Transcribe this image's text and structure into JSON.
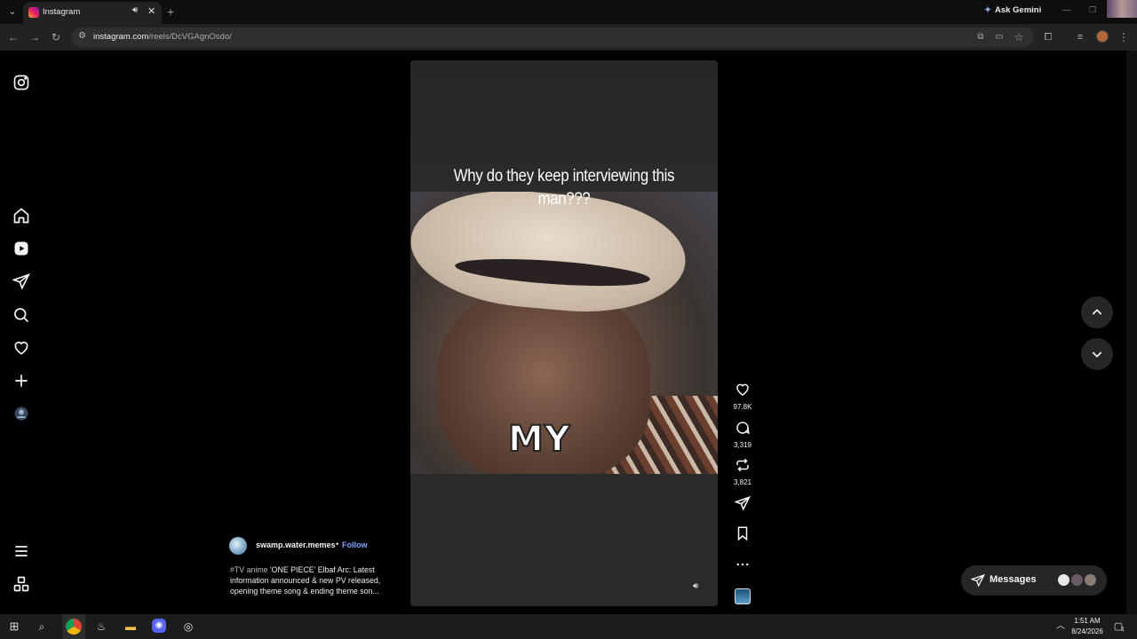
{
  "browser": {
    "tab_title": "Instagram",
    "new_tab_symbol": "+",
    "ask_gemini": "Ask Gemini",
    "url_host": "instagram.com",
    "url_path": "/reels/DcVGAgnOsdo/"
  },
  "sidebar": {
    "items": [
      {
        "name": "instagram-logo-icon"
      },
      {
        "name": "home-icon"
      },
      {
        "name": "reels-icon"
      },
      {
        "name": "messages-icon"
      },
      {
        "name": "search-icon"
      },
      {
        "name": "notifications-heart-icon"
      },
      {
        "name": "create-plus-icon"
      },
      {
        "name": "profile-avatar-icon"
      },
      {
        "name": "more-menu-icon"
      },
      {
        "name": "also-from-meta-icon"
      }
    ]
  },
  "reel": {
    "caption": "Why do they keep interviewing this man???",
    "subtitle_word": "MY",
    "actions": {
      "likes": "97.8K",
      "comments": "3,319",
      "reposts": "3,821"
    },
    "author": {
      "username": "swamp.water.memes",
      "separator": "•",
      "follow": "Follow"
    },
    "description_tags": "#TV anime",
    "description_text": " 'ONE PIECE' Elbaf Arc: Latest information announced & new PV released, opening theme song & ending theme son..."
  },
  "messages": {
    "label": "Messages"
  },
  "taskbar": {
    "time": "1:51 AM",
    "date": "8/24/2026",
    "notification_count": "1"
  },
  "colors": {
    "follow_link": "#7aa7ff",
    "background": "#000000",
    "panel": "#262626"
  }
}
